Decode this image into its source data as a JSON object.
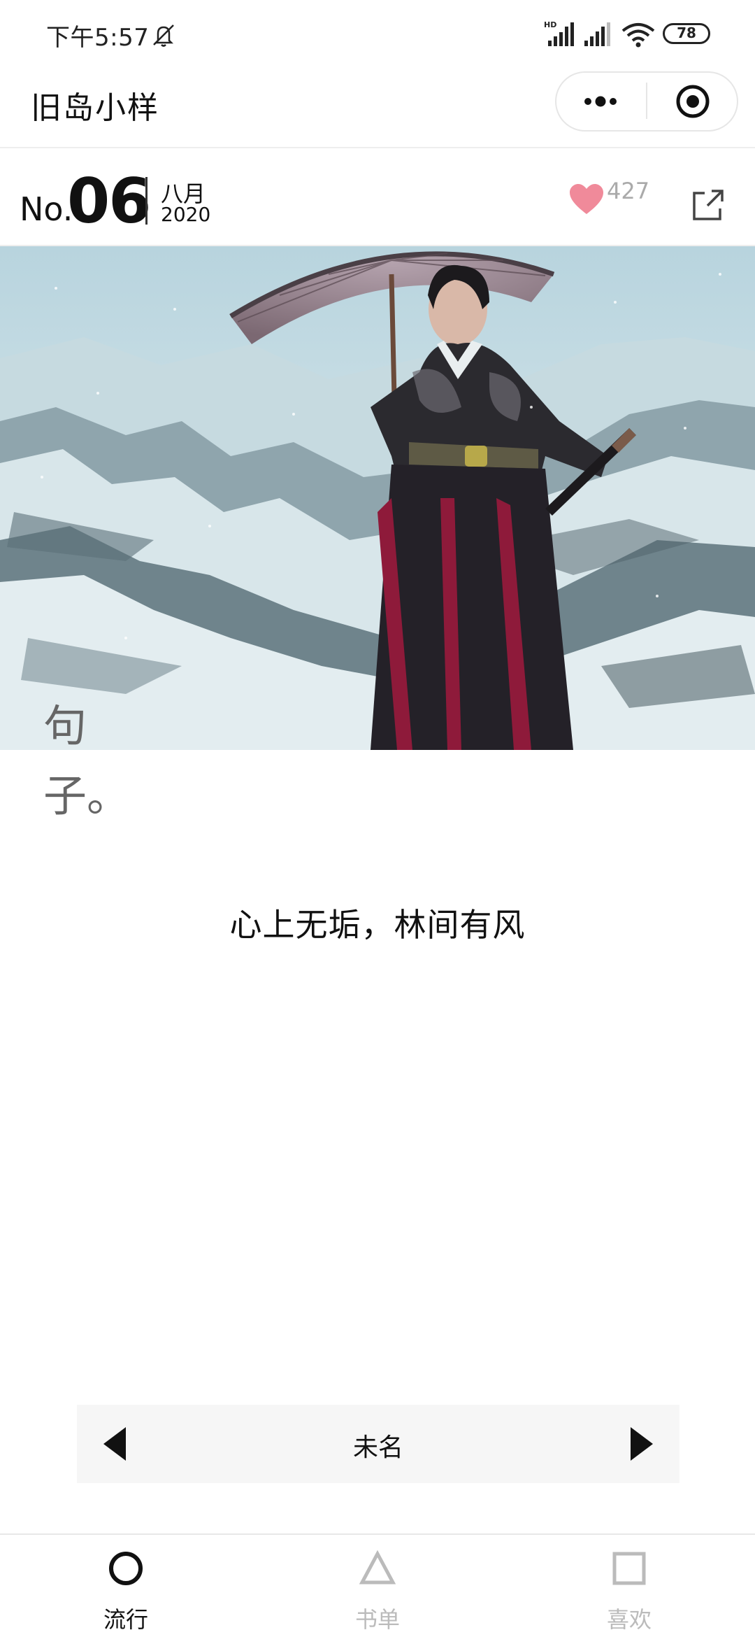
{
  "status_bar": {
    "time": "下午5:57",
    "battery": "78"
  },
  "nav": {
    "title": "旧岛小样"
  },
  "header": {
    "no_label": "No.",
    "issue_number": "06",
    "month": "八月",
    "year": "2020",
    "like_count": "427"
  },
  "content": {
    "type_label": "句子。",
    "quote": "心上无垢，林间有风"
  },
  "navigator": {
    "title": "未名"
  },
  "tabbar": {
    "items": [
      {
        "label": "流行",
        "active": true
      },
      {
        "label": "书单",
        "active": false
      },
      {
        "label": "喜欢",
        "active": false
      }
    ]
  },
  "colors": {
    "like": "#f08a9a",
    "inactive_tab": "#bbbbbb",
    "active_tab": "#111111"
  }
}
